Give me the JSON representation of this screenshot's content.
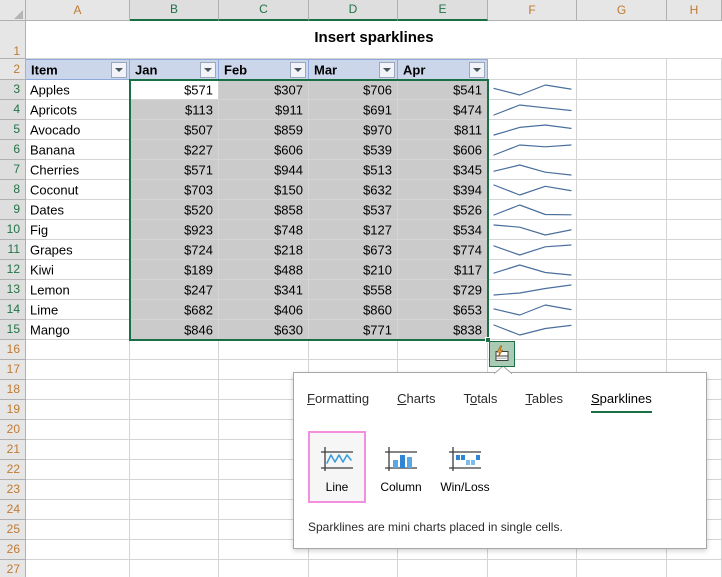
{
  "spreadsheet": {
    "column_headers": [
      "A",
      "B",
      "C",
      "D",
      "E",
      "F",
      "G",
      "H"
    ],
    "selected_columns": [
      "B",
      "C",
      "D",
      "E"
    ],
    "row_headers": [
      "1",
      "2",
      "3",
      "4",
      "5",
      "6",
      "7",
      "8",
      "9",
      "10",
      "11",
      "12",
      "13",
      "14",
      "15",
      "16",
      "17",
      "18",
      "19",
      "20",
      "21",
      "22",
      "23",
      "24",
      "25",
      "26",
      "27"
    ],
    "selected_rows": [
      "3",
      "4",
      "5",
      "6",
      "7",
      "8",
      "9",
      "10",
      "11",
      "12",
      "13",
      "14",
      "15"
    ],
    "title": "Insert sparklines",
    "table": {
      "headers": [
        "Item",
        "Jan",
        "Feb",
        "Mar",
        "Apr"
      ],
      "rows": [
        {
          "item": "Apples",
          "jan": "$571",
          "feb": "$307",
          "mar": "$706",
          "apr": "$541"
        },
        {
          "item": "Apricots",
          "jan": "$113",
          "feb": "$911",
          "mar": "$691",
          "apr": "$474"
        },
        {
          "item": "Avocado",
          "jan": "$507",
          "feb": "$859",
          "mar": "$970",
          "apr": "$811"
        },
        {
          "item": "Banana",
          "jan": "$227",
          "feb": "$606",
          "mar": "$539",
          "apr": "$606"
        },
        {
          "item": "Cherries",
          "jan": "$571",
          "feb": "$944",
          "mar": "$513",
          "apr": "$345"
        },
        {
          "item": "Coconut",
          "jan": "$703",
          "feb": "$150",
          "mar": "$632",
          "apr": "$394"
        },
        {
          "item": "Dates",
          "jan": "$520",
          "feb": "$858",
          "mar": "$537",
          "apr": "$526"
        },
        {
          "item": "Fig",
          "jan": "$923",
          "feb": "$748",
          "mar": "$127",
          "apr": "$534"
        },
        {
          "item": "Grapes",
          "jan": "$724",
          "feb": "$218",
          "mar": "$673",
          "apr": "$774"
        },
        {
          "item": "Kiwi",
          "jan": "$189",
          "feb": "$488",
          "mar": "$210",
          "apr": "$117"
        },
        {
          "item": "Lemon",
          "jan": "$247",
          "feb": "$341",
          "mar": "$558",
          "apr": "$729"
        },
        {
          "item": "Lime",
          "jan": "$682",
          "feb": "$406",
          "mar": "$860",
          "apr": "$653"
        },
        {
          "item": "Mango",
          "jan": "$846",
          "feb": "$630",
          "mar": "$771",
          "apr": "$838"
        }
      ]
    },
    "sparkline_series": [
      [
        571,
        307,
        706,
        541
      ],
      [
        113,
        911,
        691,
        474
      ],
      [
        507,
        859,
        970,
        811
      ],
      [
        227,
        606,
        539,
        606
      ],
      [
        571,
        944,
        513,
        345
      ],
      [
        703,
        150,
        632,
        394
      ],
      [
        520,
        858,
        537,
        526
      ],
      [
        923,
        748,
        127,
        534
      ],
      [
        724,
        218,
        673,
        774
      ],
      [
        189,
        488,
        210,
        117
      ],
      [
        247,
        341,
        558,
        729
      ],
      [
        682,
        406,
        860,
        653
      ],
      [
        846,
        630,
        771,
        838
      ]
    ],
    "colors": {
      "selection_border": "#1a7045",
      "selection_fill": "#cbcbcb",
      "table_header_fill": "#ccd6eb",
      "sparkline_line": "#4a6f9c",
      "header_text": "#c07a31",
      "selected_header_text": "#217346"
    }
  },
  "quick_analysis": {
    "button_icon": "quick-analysis-icon",
    "tabs": [
      {
        "label": "Formatting",
        "accel": "F",
        "active": false
      },
      {
        "label": "Charts",
        "accel": "C",
        "active": false
      },
      {
        "label": "Totals",
        "accel": "o",
        "active": false
      },
      {
        "label": "Tables",
        "accel": "T",
        "active": false
      },
      {
        "label": "Sparklines",
        "accel": "S",
        "active": true
      }
    ],
    "tiles": [
      {
        "label": "Line",
        "icon": "sparkline-line-icon",
        "selected": true
      },
      {
        "label": "Column",
        "icon": "sparkline-column-icon",
        "selected": false
      },
      {
        "label": "Win/Loss",
        "icon": "sparkline-winloss-icon",
        "selected": false
      }
    ],
    "description": "Sparklines are mini charts placed in single cells.",
    "highlight_color": "#f48fe0",
    "active_tab_underline": "#1a7045"
  }
}
